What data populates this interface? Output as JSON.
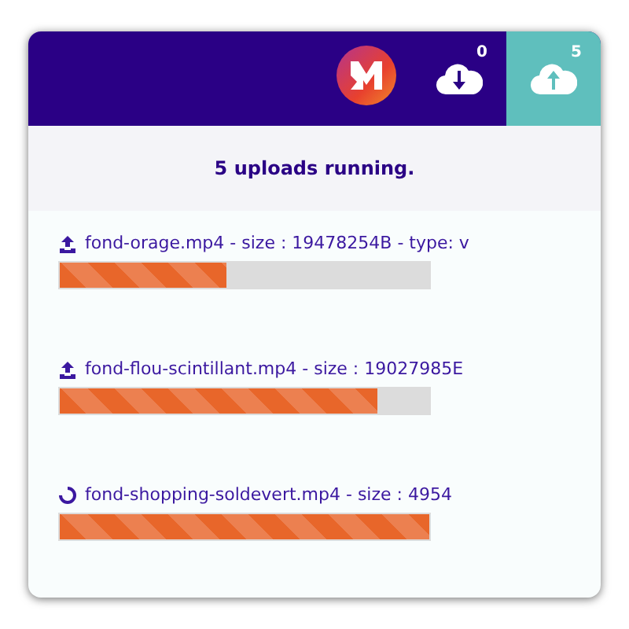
{
  "tabs": [
    {
      "kind": "download",
      "count": "0",
      "selected": false
    },
    {
      "kind": "upload",
      "count": "5",
      "selected": true
    }
  ],
  "banner": "5 uploads running.",
  "uploads": [
    {
      "kind": "uploading",
      "label": "fond-orage.mp4 - size : 19478254B - type: v",
      "level": 0.45
    },
    {
      "kind": "uploading",
      "label": "fond-flou-scintillant.mp4 - size : 19027985E",
      "level": 0.86
    },
    {
      "kind": "pending",
      "label": "fond-shopping-soldevert.mp4 - size : 4954",
      "level": 1
    }
  ]
}
